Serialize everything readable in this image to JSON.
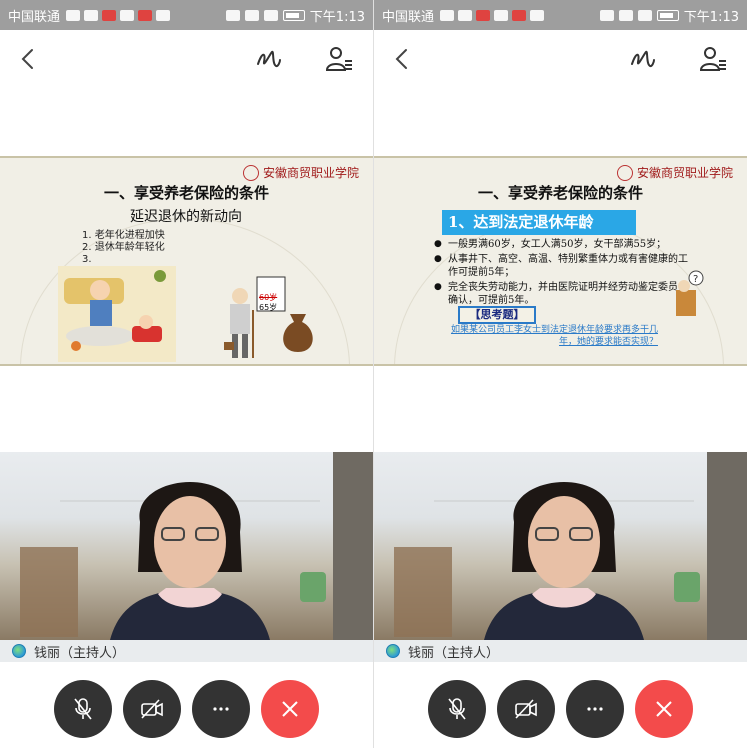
{
  "status_bar": {
    "carrier": "中国联通",
    "time": "下午1:13"
  },
  "slide_left": {
    "title": "一、享受养老保险的条件",
    "subtitle": "延迟退休的新动向",
    "items": [
      "1.  老年化进程加快",
      "2.  退休年龄年轻化",
      "3."
    ],
    "sign_top": "60岁",
    "sign_bottom": "65岁"
  },
  "slide_right": {
    "title": "一、享受养老保险的条件",
    "banner": "1、达到法定退休年龄",
    "bullets": [
      "一般男满60岁，女工人满50岁，女干部满55岁；",
      "从事井下、高空、高温、特别繁重体力或有害健康的工作可提前5年；",
      "完全丧失劳动能力，并由医院证明并经劳动鉴定委员会确认，可提前5年。"
    ],
    "think_label": "【思考题】",
    "question": "如果某公司员工李女士到法定退休年龄要求再多干几年，她的要求能否实现？"
  },
  "host": {
    "name": "钱丽（主持人）"
  },
  "icons": {
    "back": "back-icon",
    "pen": "pen-icon",
    "participants": "participants-icon",
    "mic_off": "mic-off-icon",
    "camera_off": "camera-off-icon",
    "more": "more-icon",
    "hangup": "hangup-icon"
  },
  "colors": {
    "hangup": "#f34b4b",
    "control": "#333333",
    "banner": "#2aa7e6"
  }
}
